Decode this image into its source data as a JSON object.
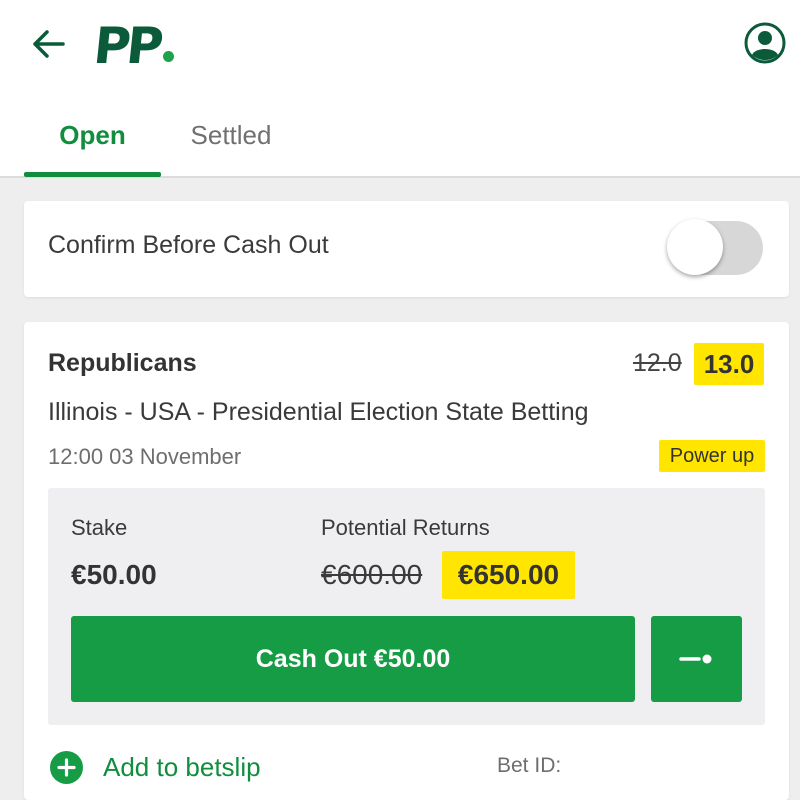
{
  "header": {
    "logo_text": "PP",
    "back_icon": "arrow-left-icon",
    "account_icon": "user-circle-icon"
  },
  "tabs": [
    {
      "label": "Open",
      "active": true
    },
    {
      "label": "Settled",
      "active": false
    }
  ],
  "settings": {
    "confirm_cashout_label": "Confirm Before Cash Out",
    "confirm_cashout_enabled": false
  },
  "bet": {
    "selection": "Republicans",
    "old_odds": "12.0",
    "new_odds": "13.0",
    "market": "Illinois - USA - Presidential Election State Betting",
    "event_time": "12:00 03 November",
    "badge": "Power up",
    "stake_label": "Stake",
    "stake_value": "€50.00",
    "returns_label": "Potential Returns",
    "old_returns": "€600.00",
    "new_returns": "€650.00",
    "cashout_label": "Cash Out €50.00",
    "add_betslip_label": "Add to betslip",
    "bet_id_label": "Bet ID:"
  },
  "colors": {
    "brand_green": "#159c45",
    "tab_green": "#108e3e",
    "logo_dark_green": "#0b5b3a",
    "highlight_yellow": "#ffe500",
    "background": "#eeeeee"
  }
}
